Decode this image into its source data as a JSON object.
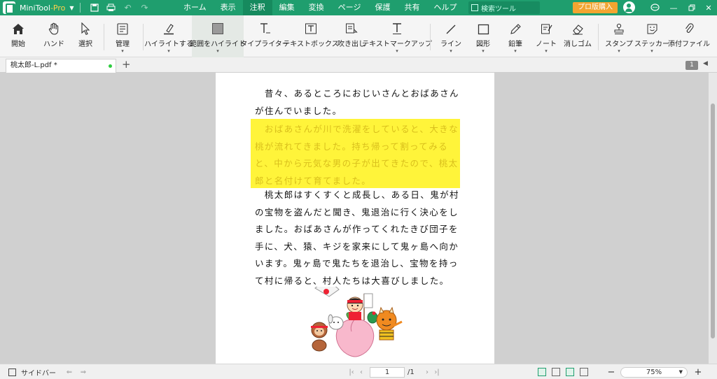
{
  "app": {
    "name": "MiniTool",
    "edition": "-Pro",
    "brand_color": "#1f9e6e"
  },
  "menu": {
    "items": [
      "ホーム",
      "表示",
      "注釈",
      "編集",
      "変換",
      "ページ",
      "保護",
      "共有",
      "ヘルプ"
    ],
    "active": "注釈"
  },
  "search": {
    "placeholder": "検索ツール"
  },
  "buy_label": "プロ版購入",
  "ribbon": {
    "home": "開始",
    "hand": "ハンド",
    "select": "選択",
    "manage": "管理",
    "highlight": "ハイライトする",
    "area_highlight": "範囲をハイライト",
    "typewriter": "タイプライター",
    "textbox": "テキストボックス",
    "callout": "吹き出し",
    "text_markup": "テキストマークアップ",
    "line": "ライン",
    "shape": "図形",
    "pencil": "鉛筆",
    "note": "ノート",
    "eraser": "消しゴム",
    "stamp": "スタンプ",
    "sticker": "ステッカー",
    "attach": "添付ファイル"
  },
  "tab": {
    "filename": "桃太郎-L.pdf *",
    "page_count_badge": "1"
  },
  "document": {
    "para1": "　昔々、あるところにおじいさんとおばあさんが住んでいました。",
    "para2": "　おばあさんが川で洗濯をしていると、大きな桃が流れてきました。持ち帰って割ってみると、中から元気な男の子が出てきたので、桃太郎と名付けて育てました。",
    "para3": "　桃太郎はすくすくと成長し、ある日、鬼が村の宝物を盗んだと聞き、鬼退治に行く決心をしました。おばあさんが作ってくれたきび団子を手に、犬、猿、キジを家来にして鬼ヶ島へ向かいます。鬼ヶ島で鬼たちを退治し、宝物を持って村に帰ると、村人たちは大喜びしました。",
    "highlight_color": "#fff43a"
  },
  "status": {
    "sidebar_label": "サイドバー",
    "current_page": "1",
    "total_pages": "/1",
    "zoom": "75%"
  }
}
